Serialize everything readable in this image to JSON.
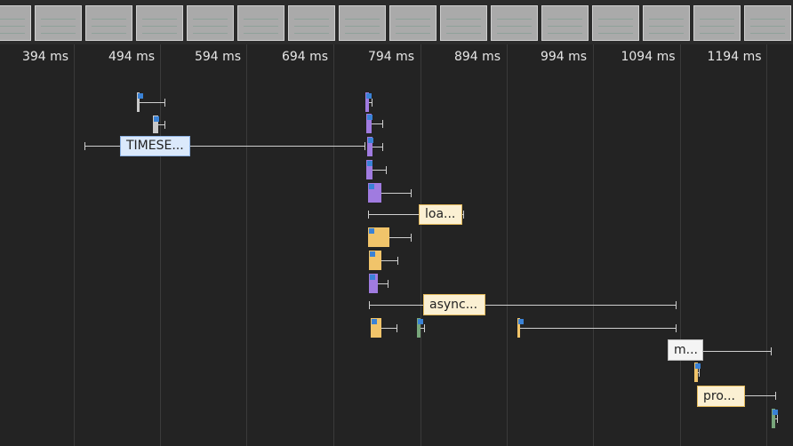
{
  "filmstrip": {
    "frame_count": 16
  },
  "timeline": {
    "ticks": [
      "394 ms",
      "494 ms",
      "594 ms",
      "694 ms",
      "794 ms",
      "894 ms",
      "994 ms",
      "1094 ms",
      "1194 ms"
    ]
  },
  "requests": [
    {
      "id": "timeset",
      "label": "TIMESE..."
    },
    {
      "id": "load",
      "label": "loa..."
    },
    {
      "id": "async",
      "label": "async..."
    },
    {
      "id": "m",
      "label": "m..."
    },
    {
      "id": "pro",
      "label": "pro..."
    }
  ],
  "colors": {
    "background": "#232323",
    "script": "#f1c46a",
    "purple": "#a07be0",
    "gray": "#c8c8c8",
    "blue_label": "#dbe9fb",
    "green": "#78a67b",
    "marker": "#3a82d6"
  }
}
